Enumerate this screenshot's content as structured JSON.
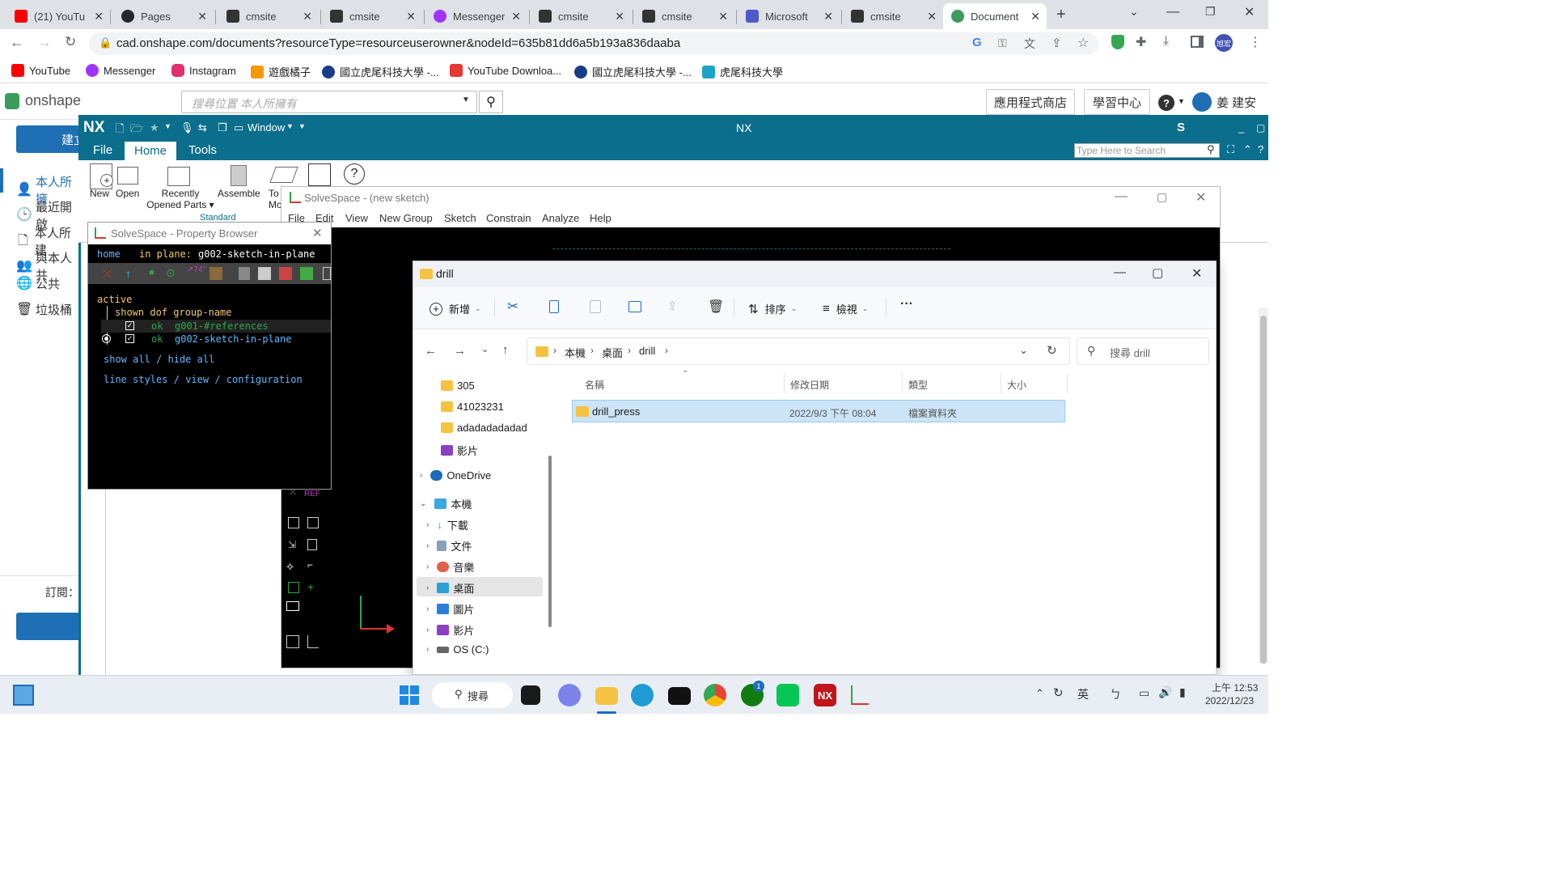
{
  "browser": {
    "tabs": [
      {
        "label": "(21) YouTu",
        "icon": "youtube-icon",
        "color": "#ff0000"
      },
      {
        "label": "Pages",
        "icon": "github-icon",
        "color": "#24292e"
      },
      {
        "label": "cmsite",
        "icon": "cmsite-icon",
        "color": "#333"
      },
      {
        "label": "cmsite",
        "icon": "cmsite-icon",
        "color": "#333"
      },
      {
        "label": "Messenger",
        "icon": "messenger-icon",
        "color": "#a033ff"
      },
      {
        "label": "cmsite",
        "icon": "cmsite-icon",
        "color": "#333"
      },
      {
        "label": "cmsite",
        "icon": "cmsite-icon",
        "color": "#333"
      },
      {
        "label": "Microsoft",
        "icon": "teams-icon",
        "color": "#5059c9"
      },
      {
        "label": "cmsite",
        "icon": "cmsite-icon",
        "color": "#333"
      },
      {
        "label": "Document",
        "icon": "onshape-icon",
        "color": "#3a9b5c",
        "active": true
      }
    ],
    "url": "cad.onshape.com/documents?resourceType=resourceuserowner&nodeId=635b81dd6a5b193a836daaba",
    "profile": "旭宏",
    "bookmarks": [
      {
        "label": "YouTube",
        "color": "#ff0000"
      },
      {
        "label": "Messenger",
        "color": "#a033ff"
      },
      {
        "label": "Instagram",
        "color": "#e1306c"
      },
      {
        "label": "遊戲橘子",
        "color": "#f39800"
      },
      {
        "label": "國立虎尾科技大學 -...",
        "color": "#1a3a8a"
      },
      {
        "label": "YouTube Downloa...",
        "color": "#e53935"
      },
      {
        "label": "國立虎尾科技大學 -...",
        "color": "#1a3a8a"
      },
      {
        "label": "虎尾科技大學",
        "color": "#1fa3c4"
      }
    ]
  },
  "onshape": {
    "logo": "onshape",
    "search_placeholder": "搜尋位置 本人所擁有",
    "app_store": "應用程式商店",
    "learning": "學習中心",
    "help": "?",
    "user": "姜 建安",
    "create": "建立",
    "side_items": [
      "本人所擁",
      "最近開啟",
      "本人所建",
      "與本人共",
      "公共",
      "垃圾桶"
    ],
    "subscribe": "訂閱："
  },
  "nx": {
    "logo": "NX",
    "window_menu": "Window",
    "title": "NX",
    "brand": "S",
    "menu": [
      "File",
      "Home",
      "Tools"
    ],
    "search_placeholder": "Type Here to Search",
    "ribbon": [
      {
        "label": "New",
        "icon": "new-part-icon"
      },
      {
        "label": "Open",
        "icon": "open-folder-icon"
      },
      {
        "label": "Recently\nOpened Parts ▾",
        "icon": "recent-parts-icon"
      },
      {
        "label": "Assemble",
        "icon": "assemble-icon"
      },
      {
        "label": "To\nMc",
        "icon": "tools-icon"
      }
    ],
    "group_label": "Standard"
  },
  "solvespace": {
    "title": "SolveSpace - (new sketch)",
    "menu": [
      "File",
      "Edit",
      "View",
      "New Group",
      "Sketch",
      "Constrain",
      "Analyze",
      "Help"
    ],
    "ref_label": "REF"
  },
  "property_browser": {
    "title": "SolveSpace - Property Browser",
    "nav_home": "home",
    "nav_plane_label": "in plane:",
    "nav_plane": "g002-sketch-in-plane",
    "active_label": "active",
    "header": "shown dof group-name",
    "groups": [
      {
        "status": "ok",
        "name": "g001-#references"
      },
      {
        "status": "ok",
        "name": "g002-sketch-in-plane"
      }
    ],
    "show_all": "show all",
    "hide_all": "hide all",
    "sep1": "/",
    "line_styles": "line styles",
    "view": "view",
    "configuration": "configuration",
    "sep2": "/"
  },
  "explorer": {
    "title": "drill",
    "toolbar": {
      "new": "新增",
      "sort": "排序",
      "view": "檢視",
      "more": "···"
    },
    "breadcrumb": [
      "本機",
      "桌面",
      "drill"
    ],
    "search_placeholder": "搜尋 drill",
    "tree": [
      {
        "label": "305",
        "type": "folder"
      },
      {
        "label": "41023231",
        "type": "folder"
      },
      {
        "label": "adadadadadad",
        "type": "folder"
      },
      {
        "label": "影片",
        "type": "video"
      },
      {
        "label": "OneDrive",
        "type": "cloud"
      },
      {
        "label": "本機",
        "type": "pc"
      },
      {
        "label": "下載",
        "type": "download"
      },
      {
        "label": "文件",
        "type": "docs"
      },
      {
        "label": "音樂",
        "type": "music"
      },
      {
        "label": "桌面",
        "type": "desktop"
      },
      {
        "label": "圖片",
        "type": "pictures"
      },
      {
        "label": "影片",
        "type": "video"
      },
      {
        "label": "OS (C:)",
        "type": "drive"
      }
    ],
    "columns": [
      "名稱",
      "修改日期",
      "類型",
      "大小"
    ],
    "files": [
      {
        "name": "drill_press",
        "modified": "2022/9/3 下午 08:04",
        "type": "檔案資料夾",
        "size": ""
      }
    ]
  },
  "taskbar": {
    "search": "搜尋",
    "lang": "英",
    "ime": "ㄅ",
    "time": "上午 12:53",
    "date": "2022/12/23",
    "badge": "1"
  }
}
